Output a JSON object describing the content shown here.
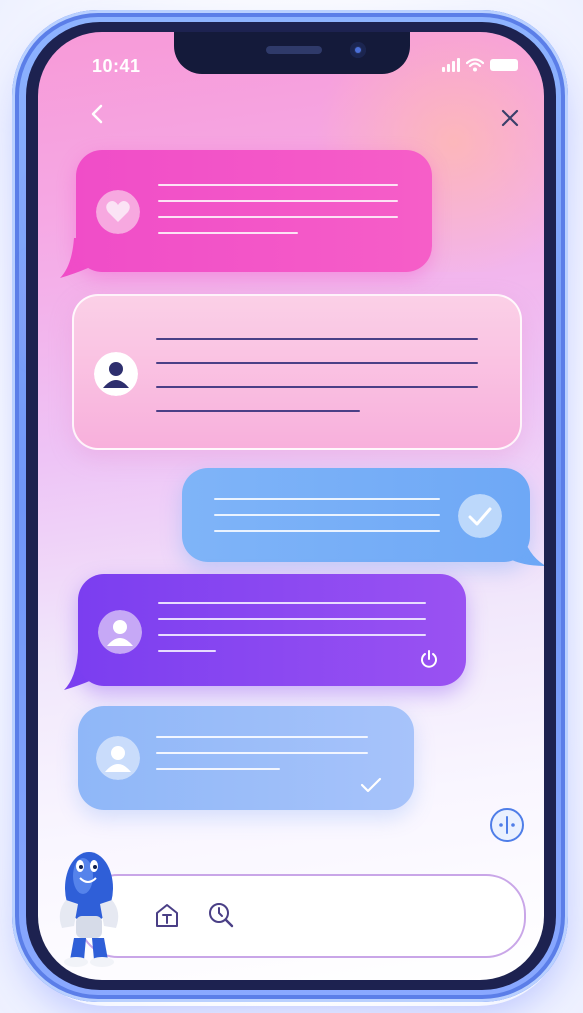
{
  "status_bar": {
    "time": "10:41"
  },
  "icons": {
    "back": "chevron-left-icon",
    "close": "close-icon",
    "fab": "sync-icon",
    "composer_left": "text-format-icon",
    "composer_right": "search-clock-icon"
  },
  "messages": [
    {
      "direction": "incoming",
      "avatar": "heart-icon"
    },
    {
      "direction": "incoming",
      "avatar": "user-icon"
    },
    {
      "direction": "outgoing",
      "status": "check-icon"
    },
    {
      "direction": "incoming",
      "avatar": "user-icon",
      "status": "power-icon"
    },
    {
      "direction": "incoming",
      "avatar": "user-icon",
      "status": "check-icon"
    }
  ],
  "colors": {
    "magenta": "#f04dc8",
    "pink": "#f8b0dc",
    "blue": "#6ea8f6",
    "purple": "#7b3ef0",
    "light_blue": "#a7c3fa",
    "frame": "#6f95f7"
  }
}
